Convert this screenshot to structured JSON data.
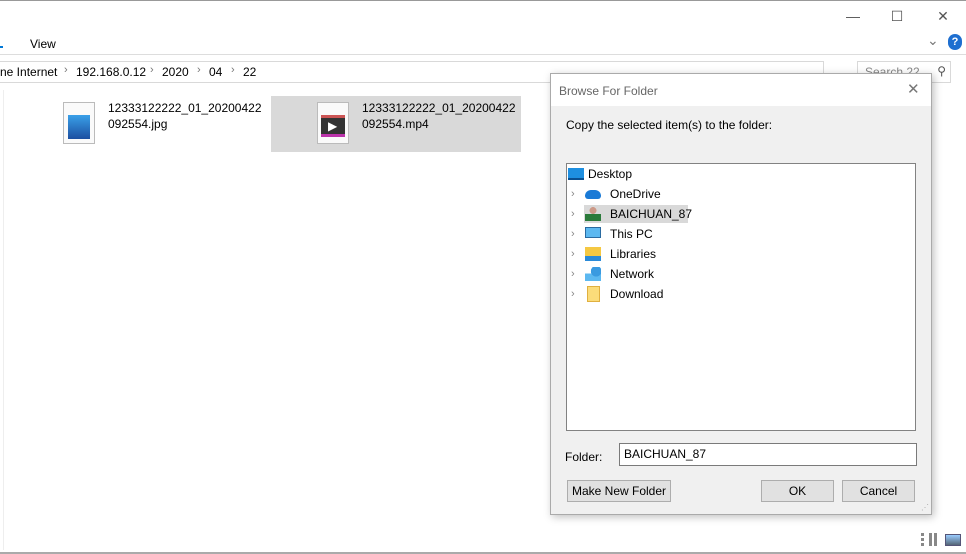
{
  "window": {
    "minimize": "—",
    "maximize": "☐",
    "close": "✕"
  },
  "ribbon": {
    "tab_view": "View",
    "help": "?",
    "expand": "⌄"
  },
  "address": {
    "crumbs": [
      "ne Internet",
      "192.168.0.12",
      "2020",
      "04",
      "22"
    ],
    "separator": "›",
    "search_placeholder": "Search 22"
  },
  "files": [
    {
      "name": "12333122222_01_20200422092554.jpg",
      "icon": "image-file-icon",
      "selected": false
    },
    {
      "name": "12333122222_01_20200422092554.mp4",
      "icon": "video-file-icon",
      "selected": true
    }
  ],
  "dialog": {
    "title": "Browse For Folder",
    "instruction": "Copy the selected item(s) to the folder:",
    "tree": [
      {
        "label": "Desktop",
        "icon": "desktop-icon",
        "expandable": false
      },
      {
        "label": "OneDrive",
        "icon": "onedrive-icon",
        "expandable": true
      },
      {
        "label": "BAICHUAN_87",
        "icon": "user-icon",
        "expandable": true,
        "selected": true
      },
      {
        "label": "This PC",
        "icon": "computer-icon",
        "expandable": true
      },
      {
        "label": "Libraries",
        "icon": "libraries-icon",
        "expandable": true
      },
      {
        "label": "Network",
        "icon": "network-icon",
        "expandable": true
      },
      {
        "label": "Download",
        "icon": "folder-icon",
        "expandable": true
      }
    ],
    "folder_label": "Folder:",
    "folder_value": "BAICHUAN_87",
    "make_new_folder": "Make New Folder",
    "ok": "OK",
    "cancel": "Cancel"
  },
  "colors": {
    "selection": "#d9d9d9",
    "accent": "#0078d7"
  }
}
